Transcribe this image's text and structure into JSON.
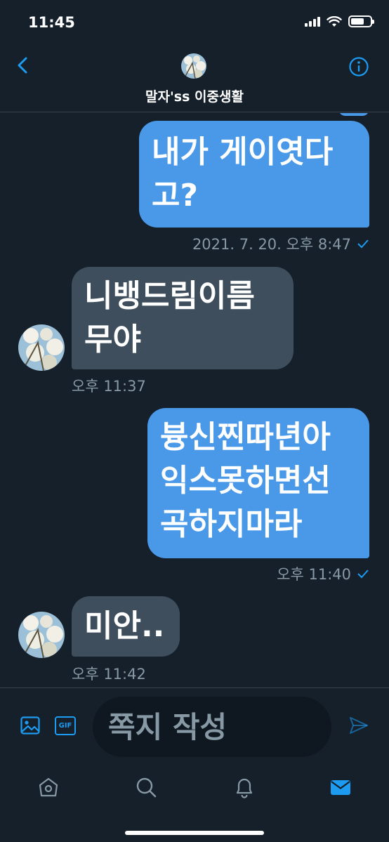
{
  "status_bar": {
    "time": "11:45"
  },
  "header": {
    "title": "말자'ss 이중생활",
    "back_icon": "chevron-left-icon",
    "info_icon": "info-icon"
  },
  "messages": [
    {
      "side": "sent",
      "lines": [
        "내가 게이엿다",
        "고?"
      ],
      "meta": "2021. 7. 20. 오후 8:47",
      "read": true
    },
    {
      "side": "received",
      "lines": [
        "니뱅드림이름",
        "무야"
      ],
      "meta": "오후 11:37"
    },
    {
      "side": "sent",
      "lines": [
        "븅신찐따년아",
        "익스못하면선",
        "곡하지마라"
      ],
      "meta": "오후 11:40",
      "read": true
    },
    {
      "side": "received",
      "lines": [
        "미안.."
      ],
      "meta": "오후 11:42"
    }
  ],
  "composer": {
    "placeholder": "쪽지 작성",
    "gif_label": "GIF",
    "media_icon": "image-icon",
    "send_icon": "send-icon"
  },
  "tabs": [
    {
      "name": "home",
      "icon": "home-icon",
      "active": false
    },
    {
      "name": "search",
      "icon": "search-icon",
      "active": false
    },
    {
      "name": "notifications",
      "icon": "bell-icon",
      "active": false
    },
    {
      "name": "messages",
      "icon": "mail-icon",
      "active": true
    }
  ],
  "colors": {
    "background": "#15202b",
    "sent_bubble": "#4a99e9",
    "received_bubble": "#3f4e5c",
    "accent": "#1d9bf0",
    "muted": "#8899a6"
  }
}
